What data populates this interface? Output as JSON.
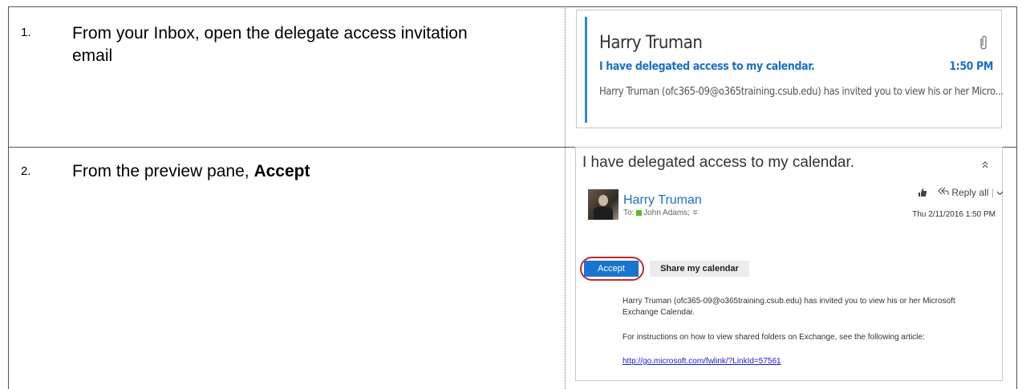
{
  "steps": [
    {
      "number": "1.",
      "text": "From your Inbox, open the delegate access invitation email"
    },
    {
      "number": "2.",
      "text_before": "From the preview pane, ",
      "text_bold": "Accept"
    }
  ],
  "email_list_item": {
    "sender": "Harry Truman",
    "subject": "I have delegated access to my calendar.",
    "time": "1:50 PM",
    "preview": "Harry Truman (ofc365-09@o365training.csub.edu) has invited you to view his or her Micro...",
    "accent_color": "#2a8ad4",
    "attachment_icon": "paperclip-icon"
  },
  "reading_pane": {
    "subject": "I have delegated access to my calendar.",
    "collapse_icon": "double-chevron-up-icon",
    "sender": "Harry Truman",
    "to_label": "To:",
    "to_recipient": "John Adams;",
    "expand_icon": "double-chevron-down-icon",
    "like_icon": "thumbs-up-icon",
    "reply_all_label": "Reply all",
    "reply_dropdown_icon": "chevron-down-icon",
    "date": "Thu 2/11/2016 1:50 PM",
    "accept_label": "Accept",
    "share_label": "Share my calendar",
    "body_paragraph_1": "Harry Truman (ofc365-09@o365training.csub.edu) has invited you to view his or her Microsoft Exchange Calendar.",
    "body_paragraph_2": "For instructions on how to view shared folders on Exchange, see the following article:",
    "link": "http://go.microsoft.com/fwlink/?LinkId=57561",
    "accept_color": "#1a75cf",
    "highlight_color": "#c2282c"
  }
}
